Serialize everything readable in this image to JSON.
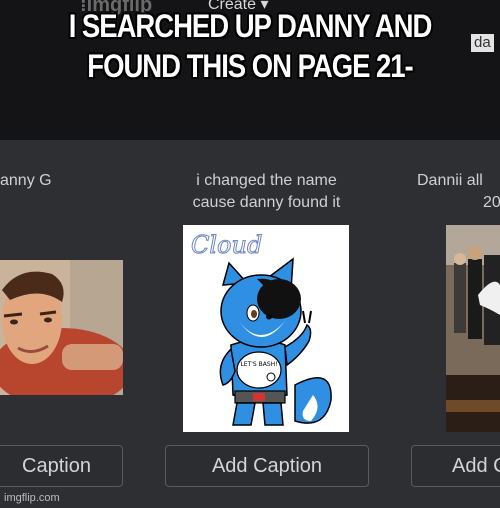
{
  "meme": {
    "caption": "I SEARCHED UP DANNY AND FOUND THIS ON PAGE 21-"
  },
  "header": {
    "create_label": "Create ▾",
    "user_fragment": "da"
  },
  "cards": [
    {
      "title": "anny G",
      "button_label": "Caption"
    },
    {
      "title_line1": "i changed the name",
      "title_line2": "cause danny found it",
      "drawing_text": "Cloud",
      "shirt_text": "LET'S BASH!",
      "button_label": "Add Caption"
    },
    {
      "title_line1": "Dannii all",
      "title_line2": "20",
      "button_label": "Add C"
    }
  ],
  "watermark": "imgflip.com",
  "colors": {
    "page_bg": "#2e2f33",
    "header_bg": "#141416",
    "caption_text": "#ffffff",
    "fur_blue": "#2f8fe3"
  }
}
